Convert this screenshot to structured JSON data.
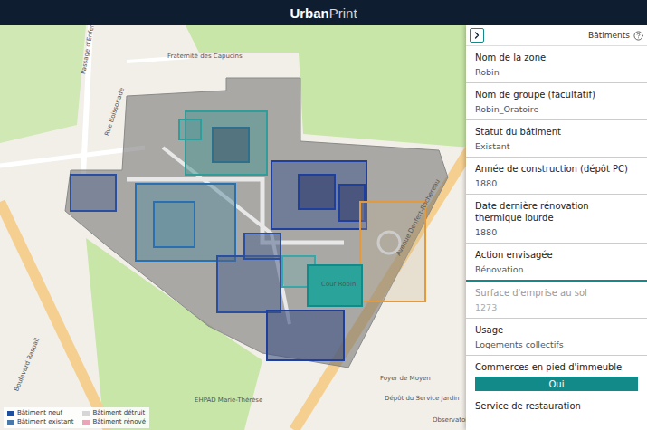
{
  "window": {
    "logo": {
      "strong": "Urban",
      "light": "Print"
    }
  },
  "map": {
    "labels": [
      "Passage d'Enfer",
      "Rue Boissonade",
      "Boulevard Raspail",
      "Avenue Denfert-Rochereau",
      "Fraternité des Capucins",
      "Cour Robin",
      "EHPAD Marie-Thérèse",
      "Dépôt du Service Jardin",
      "Observatoire",
      "Foyer de Moyen"
    ]
  },
  "legend": [
    {
      "label": "Bâtiment neuf",
      "color": "#1f4e9c"
    },
    {
      "label": "Bâtiment détruit",
      "color": "#d6d6d6"
    },
    {
      "label": "Bâtiment existant",
      "color": "#4a78a8"
    },
    {
      "label": "Bâtiment rénové",
      "color": "#e8a6b8"
    }
  ],
  "panel": {
    "title": "Bâtiments",
    "fields": [
      {
        "label": "Nom de la zone",
        "value": "Robin",
        "kind": "text",
        "disabled": false,
        "focused": false
      },
      {
        "label": "Nom de groupe (facultatif)",
        "value": "Robin_Oratoire",
        "kind": "text",
        "disabled": false,
        "focused": false
      },
      {
        "label": "Statut du bâtiment",
        "value": "Existant",
        "kind": "text",
        "disabled": false,
        "focused": false
      },
      {
        "label": "Année de construction (dépôt PC)",
        "value": "1880",
        "kind": "text",
        "disabled": false,
        "focused": false
      },
      {
        "label": "Date dernière rénovation thermique lourde",
        "value": "1880",
        "kind": "text",
        "disabled": false,
        "focused": false
      },
      {
        "label": "Action envisagée",
        "value": "Rénovation",
        "kind": "text",
        "disabled": false,
        "focused": true
      },
      {
        "label": "Surface d'emprise au sol",
        "value": "1273",
        "kind": "text",
        "disabled": true,
        "focused": false
      },
      {
        "label": "Usage",
        "value": "Logements collectifs",
        "kind": "text",
        "disabled": false,
        "focused": false
      },
      {
        "label": "Commerces en pied d'immeuble",
        "value": "Oui",
        "kind": "toggle",
        "on": true
      },
      {
        "label": "Service de restauration",
        "kind": "heading"
      }
    ]
  }
}
